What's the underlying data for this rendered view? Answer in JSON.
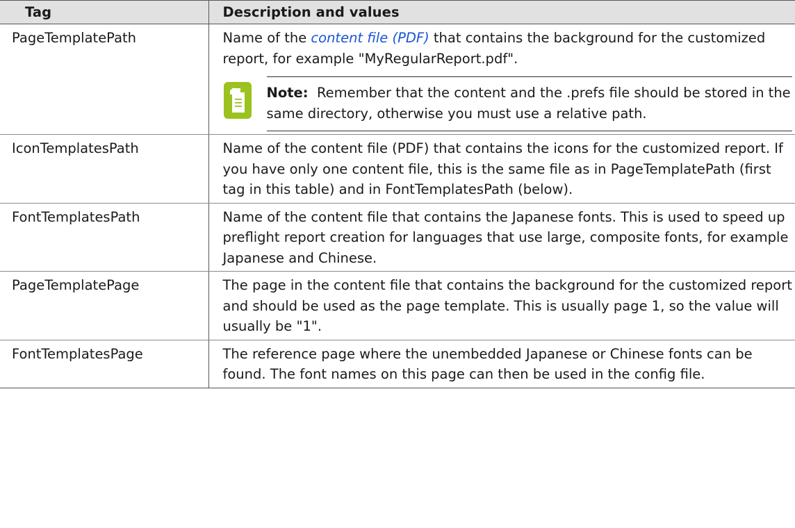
{
  "table": {
    "headers": {
      "tag": "Tag",
      "description": "Description and values"
    },
    "rows": [
      {
        "tag": "PageTemplatePath",
        "desc_before_link": "Name of the ",
        "link_text": "content file (PDF)",
        "desc_after_link": " that contains the background for the customized report, for example \"MyRegularReport.pdf\".",
        "note_label": "Note:",
        "note_text": "  Remember that the content and the .prefs file should be stored in the same directory, otherwise you must use a relative path."
      },
      {
        "tag": "IconTemplatesPath",
        "desc": "Name of the content file (PDF) that contains the icons for the customized report. If you have only one content file, this is the same file as in PageTemplatePath (first tag in this table) and in FontTemplatesPath (below)."
      },
      {
        "tag": "FontTemplatesPath",
        "desc": "Name of the content file that contains the Japanese fonts. This is used to speed up preflight report creation for languages that use large, composite fonts, for example Japanese and Chinese."
      },
      {
        "tag": "PageTemplatePage",
        "desc": "The page in the content file that contains the background for the customized report and should be used as the page template. This is usually page 1, so the value will usually be \"1\"."
      },
      {
        "tag": "FontTemplatesPage",
        "desc": "The reference page where the unembedded Japanese or Chinese fonts can be found. The font names on this page can then be used in the config file."
      }
    ]
  },
  "colors": {
    "header_bg": "#e1e1e1",
    "link": "#1a55d6",
    "note_icon": "#9bc21e"
  },
  "icons": {
    "note": "note-document-icon"
  }
}
